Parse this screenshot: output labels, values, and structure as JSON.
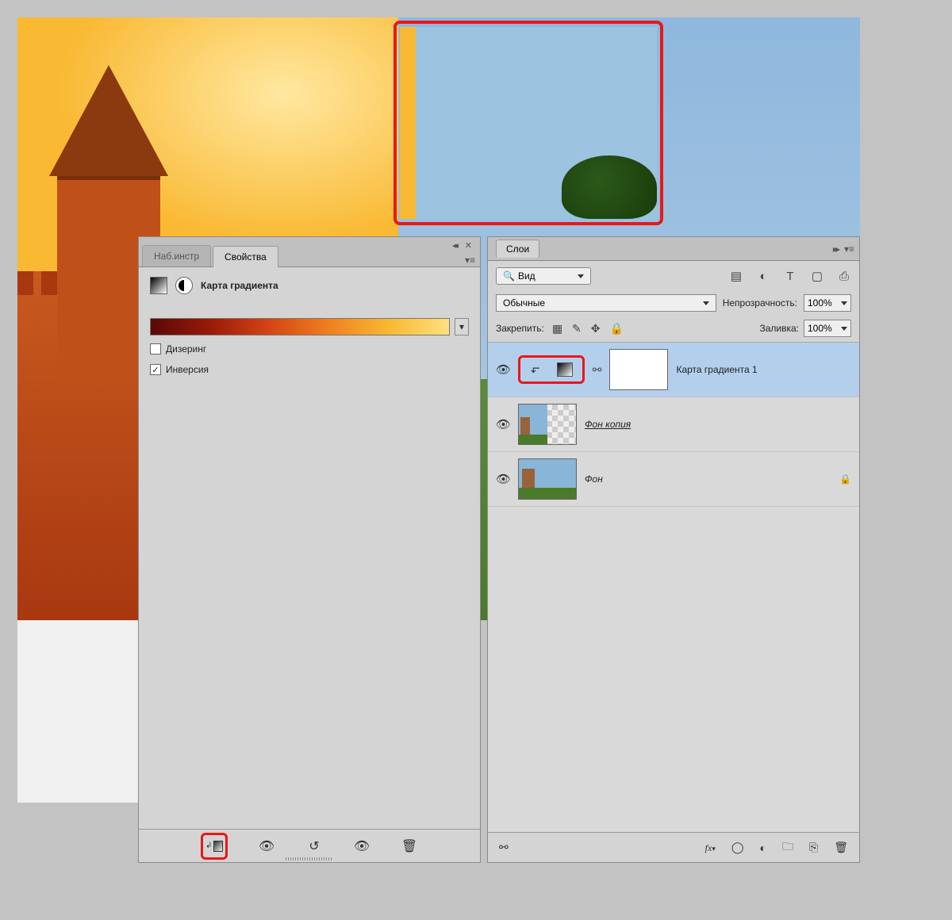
{
  "properties_panel": {
    "tabs": {
      "tools": "Наб.инстр",
      "properties": "Свойства"
    },
    "title": "Карта градиента",
    "checkboxes": {
      "dithering": "Дизеринг",
      "inversion": "Инверсия"
    },
    "inversion_checked": "✓",
    "dd_glyph": "▾"
  },
  "layers_panel": {
    "title": "Слои",
    "filter_label": "Вид",
    "blend_mode": "Обычные",
    "opacity_label": "Непрозрачность:",
    "opacity_value": "100%",
    "lock_label": "Закрепить:",
    "fill_label": "Заливка:",
    "fill_value": "100%",
    "layers": [
      {
        "name": "Карта градиента 1"
      },
      {
        "name": "Фон копия "
      },
      {
        "name": "Фон"
      }
    ],
    "fx_label": "fx"
  },
  "icons": {
    "collapse": "◂◂",
    "close": "✕",
    "menu": "▾≡",
    "expand": "▸▸",
    "eye": "👁",
    "search": "🔍",
    "image": "▤",
    "adjust": "◐",
    "text": "T",
    "shape": "▢",
    "smart": "⎙",
    "pixel": "▦",
    "brush": "✎",
    "move": "✥",
    "lock": "🔒",
    "link": "⚯",
    "reset": "↺",
    "trash": "🗑",
    "mask": "◯",
    "folder": "🗀",
    "new": "⎘",
    "clip": "↳",
    "grad": "◧",
    "dd": "▾"
  }
}
